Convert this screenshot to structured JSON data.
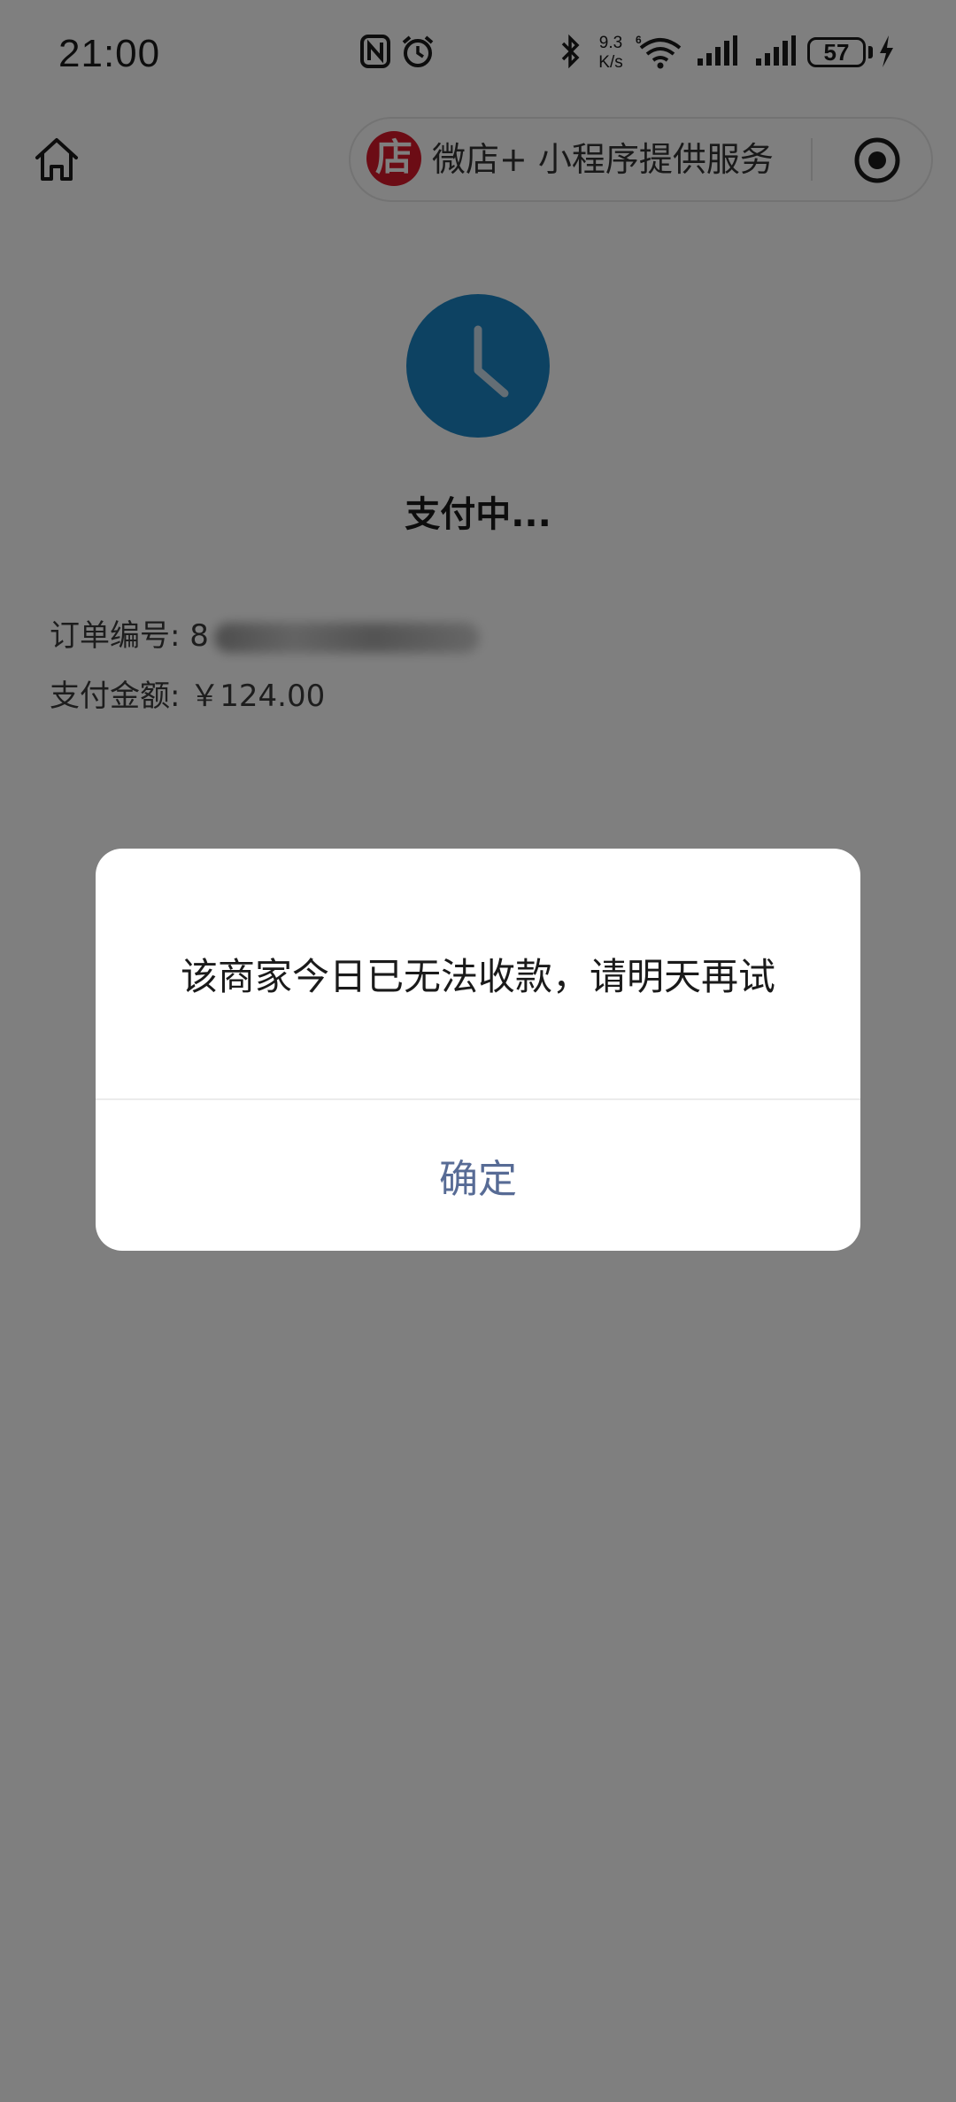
{
  "status_bar": {
    "time": "21:00",
    "net_speed_value": "9.3",
    "net_speed_unit": "K/s",
    "battery_level": "57",
    "icons": [
      "nfc-icon",
      "alarm-icon",
      "bluetooth-icon",
      "wifi-6-icon",
      "signal-icon",
      "signal-icon",
      "charging-icon"
    ]
  },
  "nav": {
    "home_icon": "home-icon",
    "shop_logo_char": "店",
    "service_text": "微店+ 小程序提供服务",
    "record_icon": "record-icon"
  },
  "payment": {
    "status_icon": "clock-icon",
    "status_text": "支付中...",
    "order_label": "订单编号: 8",
    "amount_label": "支付金额: ￥124.00"
  },
  "dialog": {
    "message": "该商家今日已无法收款，请明天再试",
    "confirm_label": "确定"
  },
  "colors": {
    "clock_blue": "#1a84c4",
    "logo_red": "#d8192a",
    "confirm_text": "#576b95",
    "mask": "rgba(0,0,0,0.5)"
  }
}
